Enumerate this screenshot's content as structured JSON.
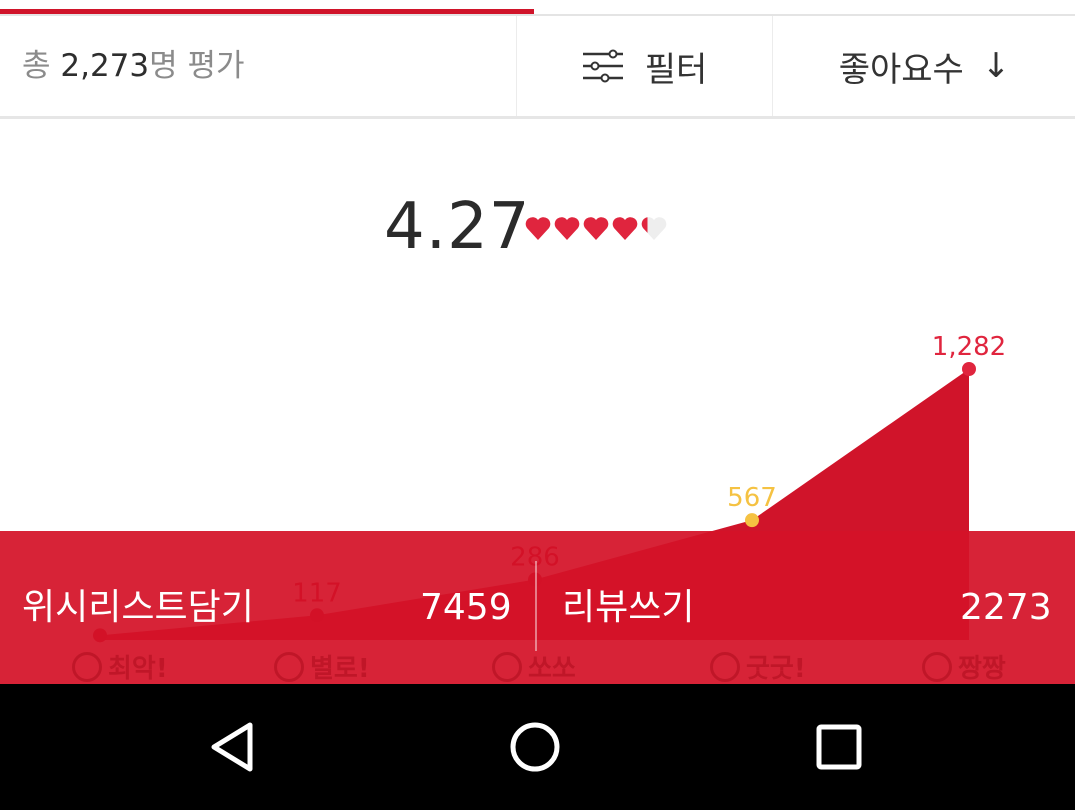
{
  "progress": {
    "fraction": 0.497
  },
  "header": {
    "total_prefix": "총 ",
    "total_count": "2,273",
    "total_suffix": "명 평가",
    "filter_label": "필터",
    "sort_label": "좋아요수",
    "sort_arrow": "↓"
  },
  "rating": {
    "value": "4.27",
    "hearts_filled": 4.27,
    "hearts_total": 5,
    "heart_color": "#e0253e"
  },
  "chart_data": {
    "type": "area",
    "categories": [
      "최악!",
      "별로!",
      "쏘쏘",
      "굿굿!",
      "짱짱"
    ],
    "values": [
      22,
      117,
      286,
      567,
      1282
    ],
    "labels": [
      "",
      "117",
      "286",
      "567",
      "1,282"
    ],
    "highlight_colors": [
      "#c2001b",
      "#c2001b",
      "#c2001b",
      "#f5c242",
      "#e0253e"
    ]
  },
  "actions": {
    "wishlist_label": "위시리스트담기",
    "wishlist_count": "7459",
    "review_label": "리뷰쓰기",
    "review_count": "2273"
  },
  "nav": {
    "back_icon": "back-triangle-icon",
    "home_icon": "home-circle-icon",
    "recents_icon": "recents-square-icon"
  },
  "colors": {
    "accent": "#d0142a",
    "bar": "#d41228",
    "navbar": "#000000"
  }
}
